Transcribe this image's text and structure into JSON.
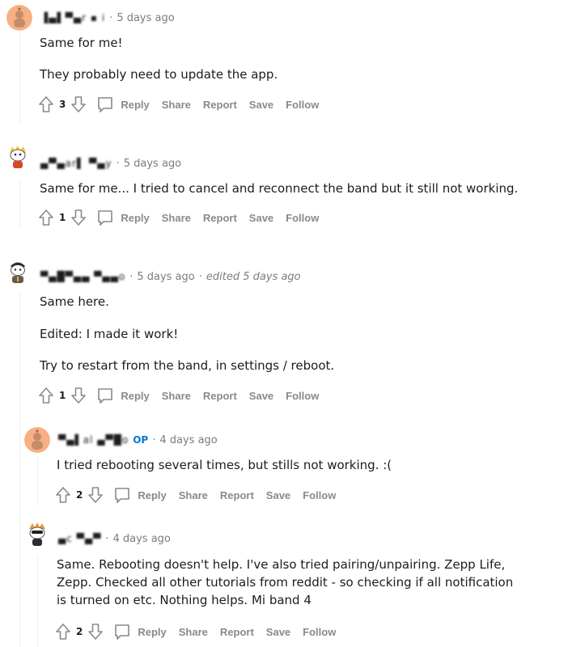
{
  "comments": [
    {
      "username": "▐▄▌▀▄r ▪ i",
      "time": "5 days ago",
      "paragraphs": [
        "Same for me!",
        "They probably need to update the app."
      ],
      "score": "3"
    },
    {
      "username": "▄▀▄ar▌ ▀▄y",
      "time": "5 days ago",
      "paragraphs": [
        "Same for me... I tried to cancel and reconnect the band but it still not working."
      ],
      "score": "1"
    },
    {
      "username": "▀▄█▀▄▄ ▀▄▄o",
      "time": "5 days ago",
      "edited": "edited 5 days ago",
      "paragraphs": [
        "Same here.",
        "Edited: I made it work!",
        "Try to restart from the band, in settings / reboot."
      ],
      "score": "1"
    },
    {
      "username": "▀▄▌al  ▄▀█o",
      "op": "OP",
      "time": "4 days ago",
      "paragraphs": [
        "I tried rebooting several times, but stills not working. :("
      ],
      "score": "2"
    },
    {
      "username": "  ▄c  ▀▄▀",
      "time": "4 days ago",
      "paragraphs": [
        "Same. Rebooting doesn't help. I've also tried pairing/unpairing. Zepp Life, Zepp. Checked all other tutorials from reddit - so checking if all notification is turned on etc. Nothing helps. Mi band 4"
      ],
      "score": "2"
    }
  ],
  "actions": {
    "reply": "Reply",
    "share": "Share",
    "report": "Report",
    "save": "Save",
    "follow": "Follow"
  },
  "separator": "·",
  "colors": {
    "text": "#1c1c1c",
    "meta": "#7c7c7c",
    "action": "#878a8c",
    "op_badge": "#0079d3",
    "thread_line": "#edeff1",
    "avatar_orange": "#f7b083"
  },
  "icons": {
    "upvote": "upvote-arrow-icon",
    "downvote": "downvote-arrow-icon",
    "reply": "comment-bubble-icon"
  }
}
